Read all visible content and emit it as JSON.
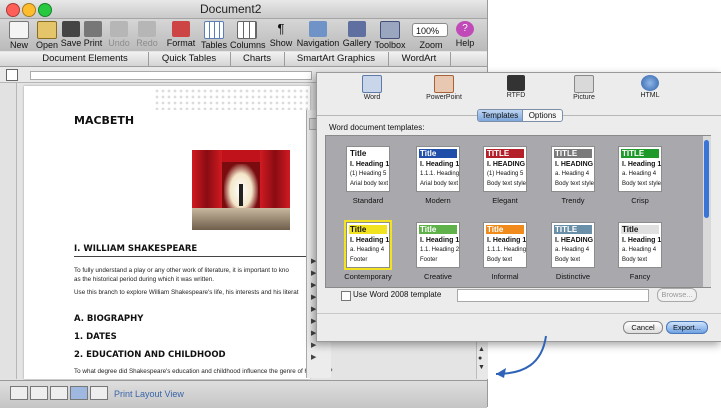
{
  "window": {
    "title": "Document2"
  },
  "toolbar": [
    {
      "label": "New"
    },
    {
      "label": "Open"
    },
    {
      "label": "Save"
    },
    {
      "label": "Print"
    },
    {
      "label": "Undo"
    },
    {
      "label": "Redo"
    },
    {
      "label": "Format"
    },
    {
      "label": "Tables"
    },
    {
      "label": "Columns"
    },
    {
      "label": "Show"
    },
    {
      "label": "Navigation"
    },
    {
      "label": "Gallery"
    },
    {
      "label": "Toolbox"
    },
    {
      "label": "Zoom"
    },
    {
      "label": "Help"
    }
  ],
  "zoom": {
    "value": "100%"
  },
  "elements_bar": [
    "Document Elements",
    "Quick Tables",
    "Charts",
    "SmartArt Graphics",
    "WordArt"
  ],
  "document": {
    "title": "MACBETH",
    "heading1": "I. WILLIAM SHAKESPEARE",
    "para1a": "To fully understand a play or any other work of literature, it is important to kno",
    "para1b": "as the historical period during which it was written.",
    "para2": "Use this branch to explore William Shakespeare's life, his interests and his literat",
    "heading_a": "A. BIOGRAPHY",
    "heading_1": "1. DATES",
    "heading_2": "2. EDUCATION AND CHILDHOOD",
    "para3": "To what degree did Shakespeare's education and childhood influence the genre of his plays?"
  },
  "status": {
    "view_label": "Print Layout View"
  },
  "dialog": {
    "formats": [
      "Word",
      "PowerPoint",
      "RTFD",
      "Picture",
      "HTML"
    ],
    "tabs": [
      "Templates",
      "Options"
    ],
    "section_label": "Word document templates:",
    "templates": [
      {
        "name": "Standard",
        "lines": [
          "Title",
          "I. Heading 1",
          "(1) Heading 5",
          "Arial body text"
        ],
        "color": "#ffffff"
      },
      {
        "name": "Modern",
        "lines": [
          "Title",
          "I. Heading 1",
          "1.1.1. Heading 3",
          "Arial body text"
        ],
        "color": "#1f4fa8"
      },
      {
        "name": "Elegant",
        "lines": [
          "TITLE",
          "I. HEADING 1",
          "(1) Heading 5",
          "Body text style"
        ],
        "color": "#b3202a"
      },
      {
        "name": "Trendy",
        "lines": [
          "TITLE",
          "I. HEADING 1",
          "a. Heading 4",
          "Body text style"
        ],
        "color": "#7a7a7a"
      },
      {
        "name": "Crisp",
        "lines": [
          "TITLE",
          "I. Heading 1",
          "a. Heading 4",
          "Body text style"
        ],
        "color": "#1f9a2a"
      },
      {
        "name": "Contemporary",
        "lines": [
          "Title",
          "I. Heading 1",
          "a. Heading 4",
          "Footer"
        ],
        "color": "#f2e320"
      },
      {
        "name": "Creative",
        "lines": [
          "Title",
          "I. Heading 1",
          "1.1. Heading 2",
          "Footer"
        ],
        "color": "#5fb14a"
      },
      {
        "name": "Informal",
        "lines": [
          "Title",
          "I. Heading 1",
          "1.1.1. Heading 3",
          "Body text"
        ],
        "color": "#f08a1a"
      },
      {
        "name": "Distinctive",
        "lines": [
          "TITLE",
          "I. HEADING 1",
          "a. Heading 4",
          "Body text"
        ],
        "color": "#6a8fa8"
      },
      {
        "name": "Fancy",
        "lines": [
          "Title",
          "I. Heading 1",
          "a. Heading 4",
          "Body text"
        ],
        "color": "#e0e0e0"
      }
    ],
    "checkbox_label": "Use Word 2008 template",
    "browse_label": "Browse...",
    "cancel_label": "Cancel",
    "export_label": "Export..."
  },
  "colors": {
    "accent": "#3875d7",
    "dialog_bg": "#ececec",
    "grid_bg": "#a9a9ad",
    "curtain": "#c0121a"
  }
}
